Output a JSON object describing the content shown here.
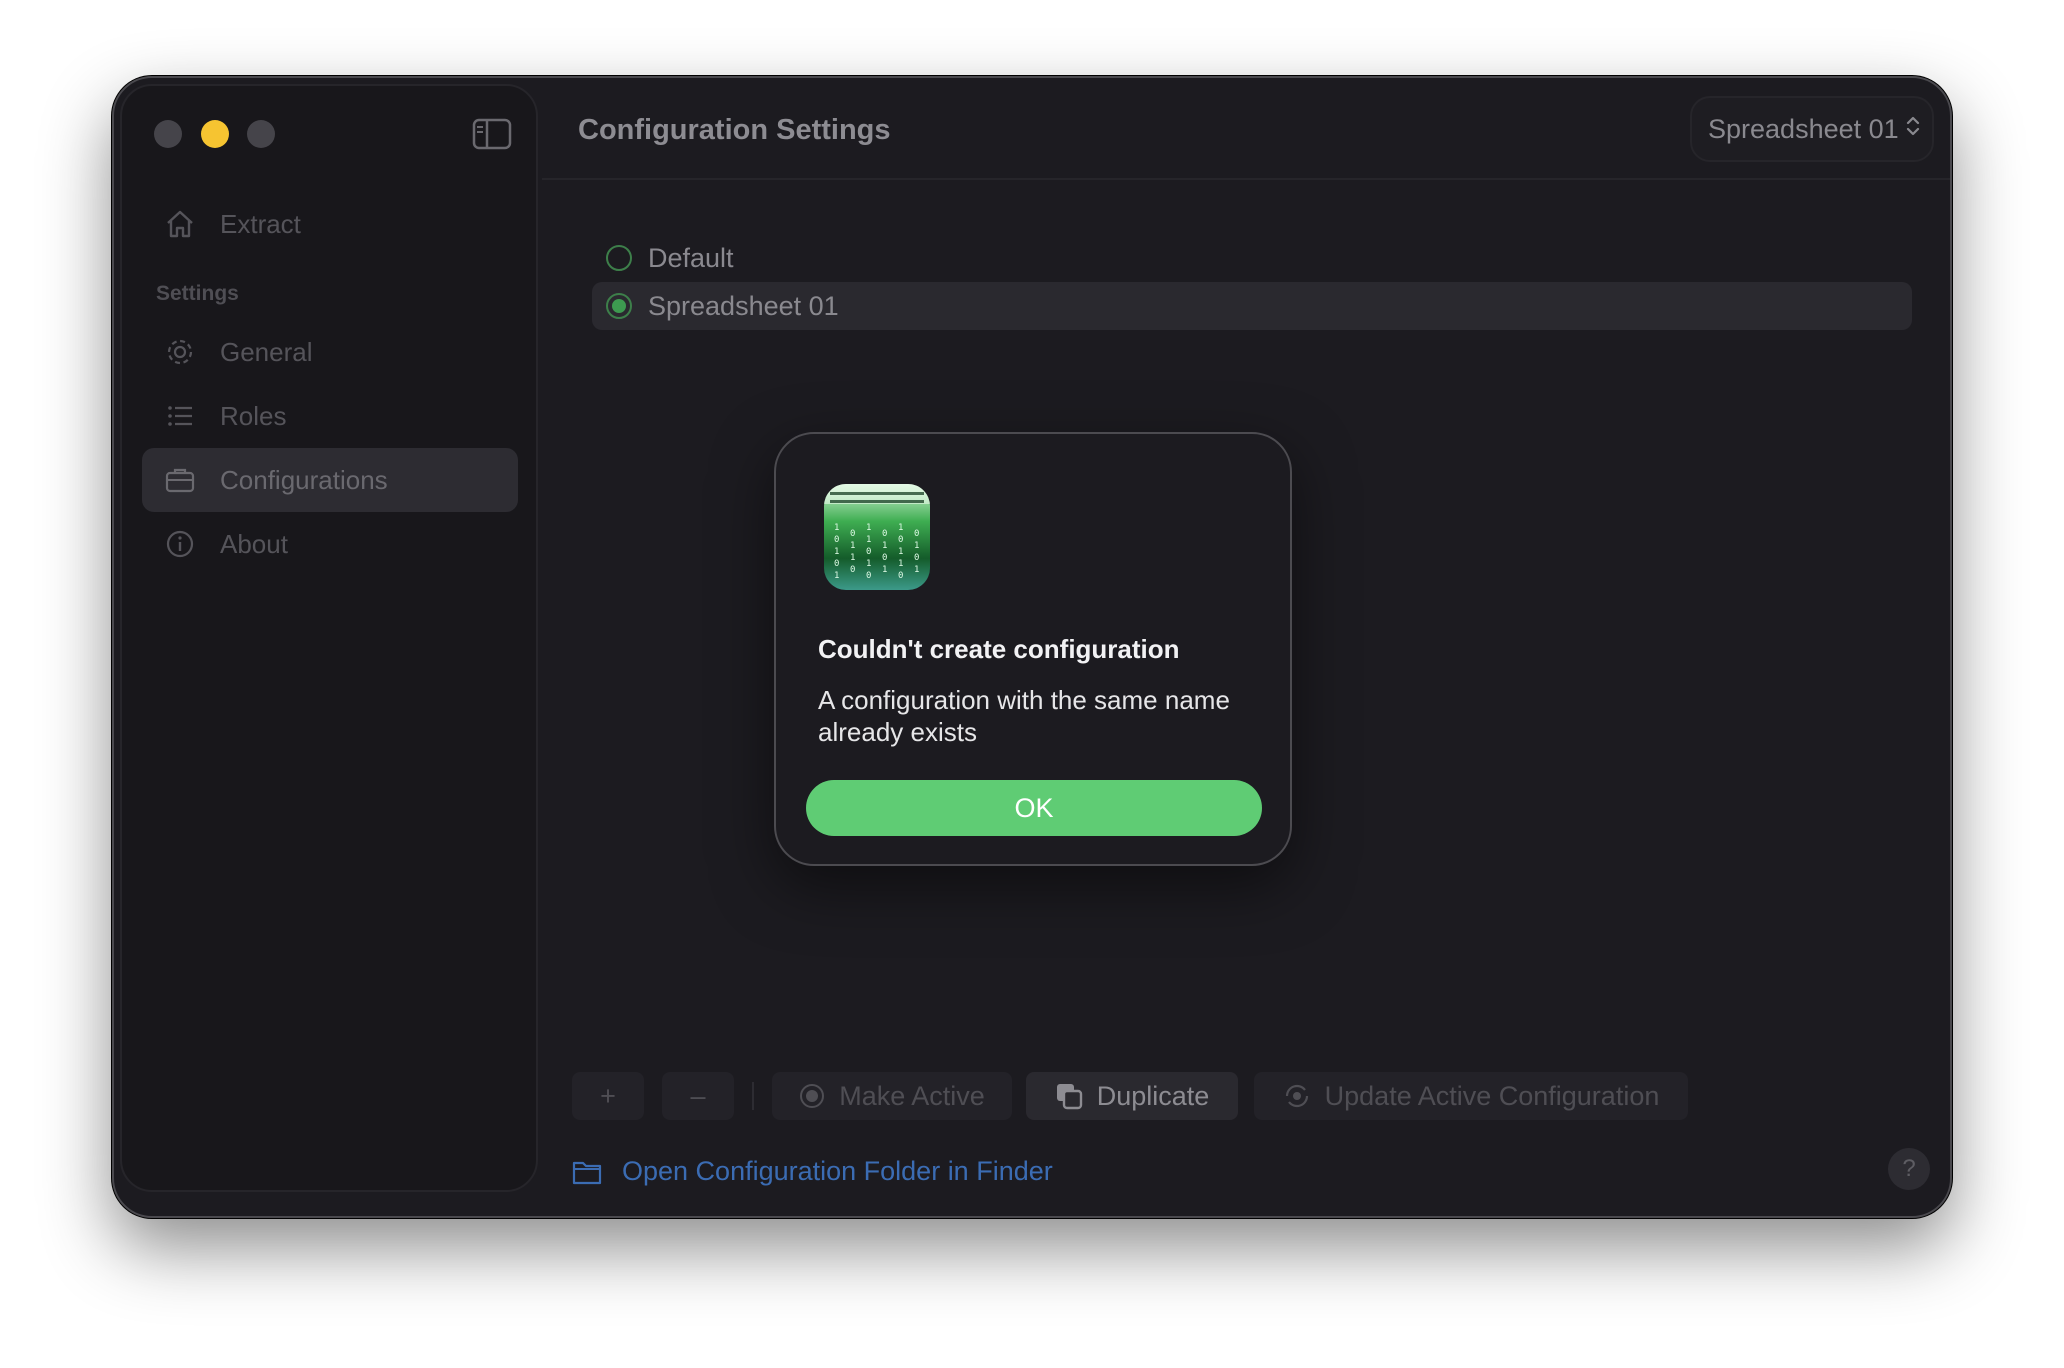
{
  "sidebar": {
    "items": [
      {
        "label": "Extract",
        "icon": "house-icon"
      },
      {
        "label": "General",
        "icon": "gear-icon"
      },
      {
        "label": "Roles",
        "icon": "list-icon"
      },
      {
        "label": "Configurations",
        "icon": "briefcase-icon"
      },
      {
        "label": "About",
        "icon": "info-icon"
      }
    ],
    "section_label": "Settings",
    "active_item": "Configurations"
  },
  "header": {
    "title": "Configuration Settings",
    "picker_value": "Spreadsheet 01"
  },
  "configurations": [
    {
      "label": "Default",
      "selected": false
    },
    {
      "label": "Spreadsheet 01",
      "selected": true
    }
  ],
  "toolbar": {
    "add_label": "+",
    "remove_label": "–",
    "make_active_label": "Make Active",
    "duplicate_label": "Duplicate",
    "update_label": "Update Active Configuration"
  },
  "footer": {
    "open_folder_label": "Open Configuration Folder in Finder",
    "help_label": "?"
  },
  "dialog": {
    "title": "Couldn't create configuration",
    "message": "A configuration with the same name already exists",
    "ok_label": "OK"
  },
  "colors": {
    "accent_green": "#5fcc74",
    "link_blue": "#3b6cb3",
    "traffic_yellow": "#f6c431"
  }
}
